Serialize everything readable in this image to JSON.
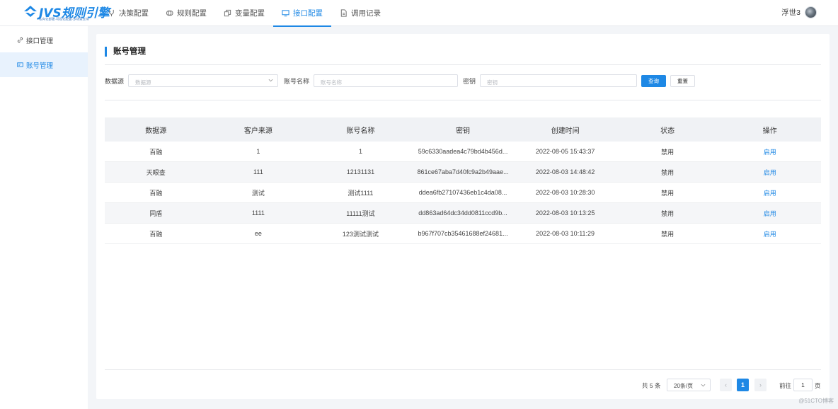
{
  "header": {
    "logo_title": "JVS规则引擎",
    "logo_subtitle": "私有化部署·可视化配置·多场景支持",
    "nav": [
      {
        "label": "决策配置",
        "icon": "branch-icon",
        "active": false
      },
      {
        "label": "规则配置",
        "icon": "rules-icon",
        "active": false
      },
      {
        "label": "变量配置",
        "icon": "variables-icon",
        "active": false
      },
      {
        "label": "接口配置",
        "icon": "monitor-icon",
        "active": true
      },
      {
        "label": "调用记录",
        "icon": "document-icon",
        "active": false
      }
    ],
    "user_name": "浮世3"
  },
  "sidebar": {
    "items": [
      {
        "label": "接口管理",
        "icon": "link-icon",
        "active": false
      },
      {
        "label": "账号管理",
        "icon": "card-icon",
        "active": true
      }
    ]
  },
  "page": {
    "title": "账号管理"
  },
  "filters": {
    "datasource_label": "数据源",
    "datasource_placeholder": "数据源",
    "account_label": "账号名称",
    "account_placeholder": "账号名称",
    "secret_label": "密钥",
    "secret_placeholder": "密钥",
    "search_button": "查询",
    "reset_button": "重置"
  },
  "table": {
    "columns": [
      "数据源",
      "客户来源",
      "账号名称",
      "密钥",
      "创建时间",
      "状态",
      "操作"
    ],
    "rows": [
      [
        "百融",
        "1",
        "1",
        "59c6330aadea4c79bd4b456d...",
        "2022-08-05 15:43:37",
        "禁用",
        "启用"
      ],
      [
        "天眼查",
        "111",
        "12131131",
        "861ce67aba7d40fc9a2b49aae...",
        "2022-08-03 14:48:42",
        "禁用",
        "启用"
      ],
      [
        "百融",
        "测试",
        "测试1111",
        "ddea6fb27107436eb1c4da08...",
        "2022-08-03 10:28:30",
        "禁用",
        "启用"
      ],
      [
        "同盾",
        "1111",
        "11111测试",
        "dd863ad64dc34dd0811ccd9b...",
        "2022-08-03 10:13:25",
        "禁用",
        "启用"
      ],
      [
        "百融",
        "ee",
        "123测试测试",
        "b967f707cb35461688ef24681...",
        "2022-08-03 10:11:29",
        "禁用",
        "启用"
      ]
    ]
  },
  "pagination": {
    "total_text": "共 5 条",
    "page_size": "20条/页",
    "prev": "‹",
    "current_page": "1",
    "next": "›",
    "goto_label": "前往",
    "goto_value": "1",
    "page_unit": "页"
  },
  "watermark": "@51CTO博客",
  "colors": {
    "accent": "#1e88e5",
    "background": "#f3f5f8",
    "table_header": "#f0f2f5"
  }
}
